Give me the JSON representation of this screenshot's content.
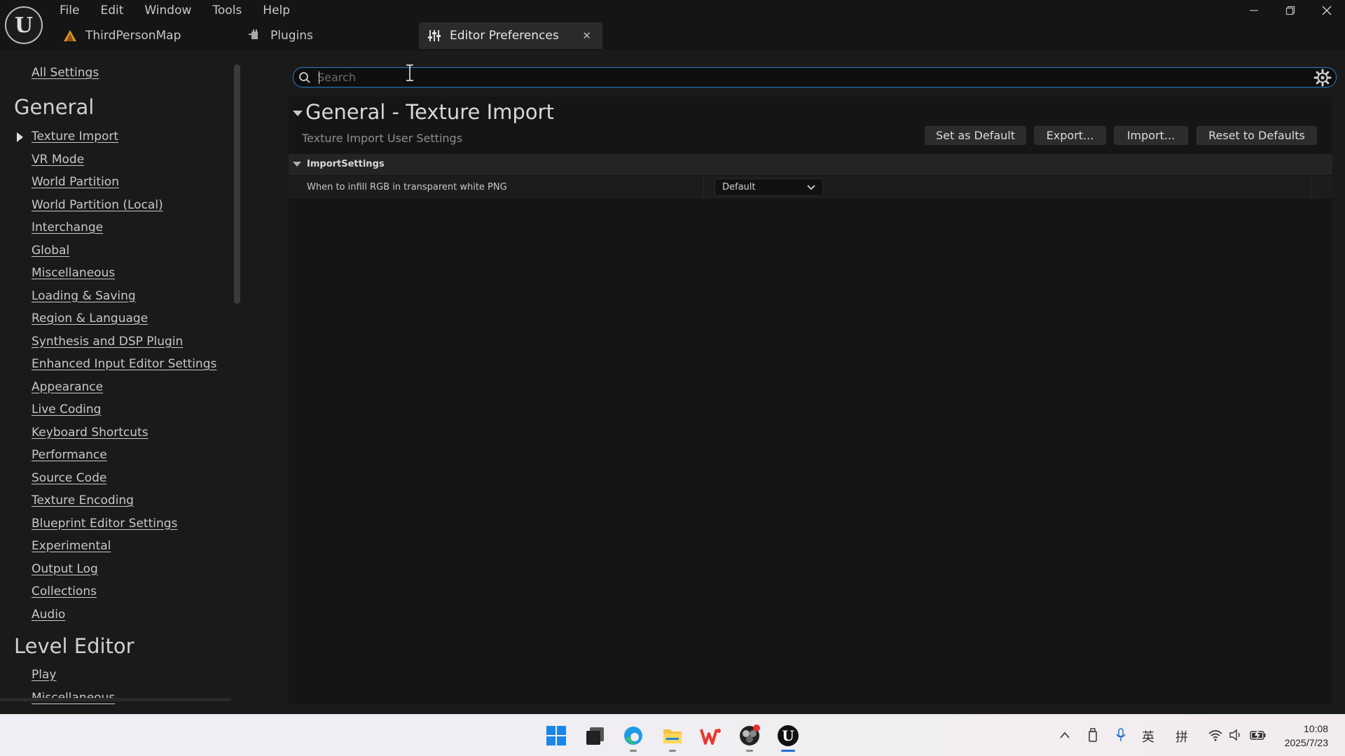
{
  "menu": [
    "File",
    "Edit",
    "Window",
    "Tools",
    "Help"
  ],
  "tabs": {
    "map": "ThirdPersonMap",
    "plugins": "Plugins",
    "prefs": "Editor Preferences"
  },
  "sidebar": {
    "all_settings": "All Settings",
    "general_header": "General",
    "general_items": [
      "Texture Import",
      "VR Mode",
      "World Partition",
      "World Partition (Local)",
      "Interchange",
      "Global",
      "Miscellaneous",
      "Loading & Saving",
      "Region & Language",
      "Synthesis and DSP Plugin",
      "Enhanced Input Editor Settings",
      "Appearance",
      "Live Coding",
      "Keyboard Shortcuts",
      "Performance",
      "Source Code",
      "Texture Encoding",
      "Blueprint Editor Settings",
      "Experimental",
      "Output Log",
      "Collections",
      "Audio"
    ],
    "level_editor_header": "Level Editor",
    "level_items": [
      "Play",
      "Miscellaneous"
    ]
  },
  "search": {
    "placeholder": "Search",
    "value": ""
  },
  "content": {
    "title": "General - Texture Import",
    "subtitle": "Texture Import User Settings",
    "buttons": {
      "set_default": "Set as Default",
      "export": "Export...",
      "import": "Import...",
      "reset": "Reset to Defaults"
    },
    "category": "ImportSettings",
    "property": {
      "label": "When to infill RGB in transparent white PNG",
      "value": "Default"
    }
  },
  "tray": {
    "lang1": "英",
    "lang2": "拼"
  },
  "clock": {
    "time": "10:08",
    "date": "2025/7/23"
  },
  "colors": {
    "accent": "#2f7cc4",
    "panel_bg": "#151515",
    "sidebar_bg": "#1a1a1a"
  }
}
